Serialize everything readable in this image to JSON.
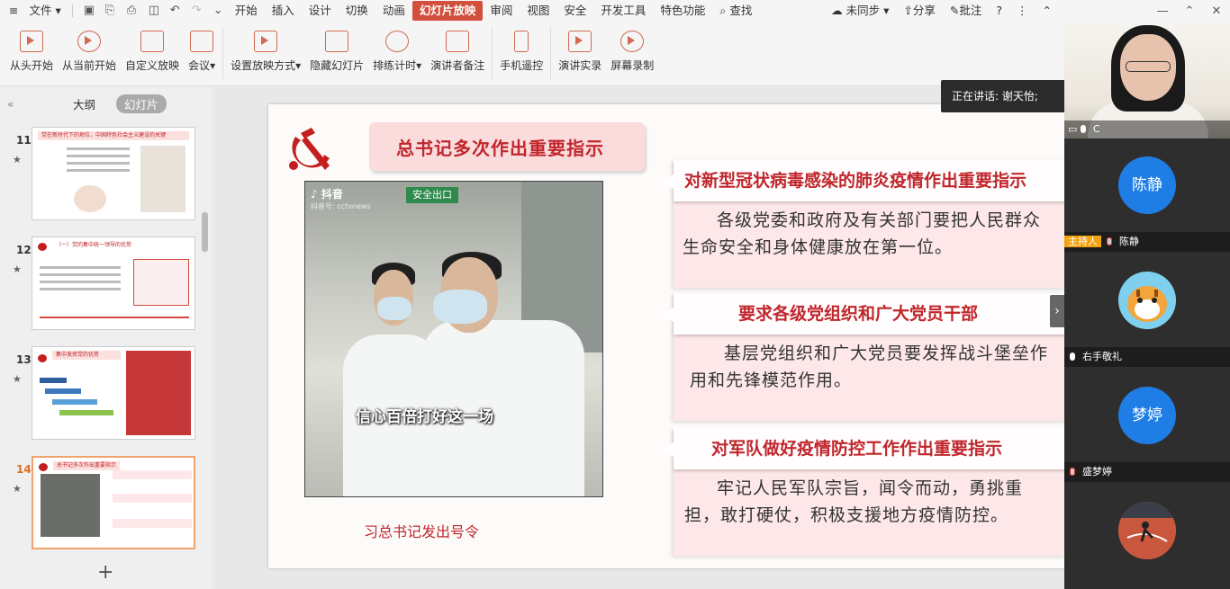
{
  "menubar": {
    "file": "文件",
    "tabs": [
      "开始",
      "插入",
      "设计",
      "切换",
      "动画",
      "幻灯片放映",
      "审阅",
      "视图",
      "安全",
      "开发工具",
      "特色功能"
    ],
    "active_tab": "幻灯片放映",
    "search": "查找",
    "sync": "未同步",
    "share": "分享",
    "comment": "批注",
    "help": "?"
  },
  "ribbon": {
    "buttons": [
      "从头开始",
      "从当前开始",
      "自定义放映",
      "会议",
      "设置放映方式",
      "隐藏幻灯片",
      "排练计时",
      "演讲者备注",
      "手机遥控",
      "演讲实录",
      "屏幕录制"
    ]
  },
  "left_panel": {
    "tab_outline": "大纲",
    "tab_slides": "幻灯片",
    "thumbnails": [
      {
        "num": "11",
        "title": "党在新时代下的地位，中国特色社会主义建设的关键"
      },
      {
        "num": "12",
        "title": "（一）党的集中统一领导的优势"
      },
      {
        "num": "13",
        "title": "集中发挥党的优势"
      },
      {
        "num": "14",
        "title": "总书记多次作出重要指示"
      }
    ],
    "selected": "14",
    "add": "+"
  },
  "slide": {
    "title": "总书记多次作出重要指示",
    "video": {
      "logo": "♪ 抖音",
      "account": "抖音号: cctvnews",
      "exit_sign": "安全出口",
      "caption": "信心百倍打好这一场"
    },
    "video_caption": "习总书记发出号令",
    "cards": [
      {
        "heading": "对新型冠状病毒感染的肺炎疫情作出重要指示",
        "body": "各级党委和政府及有关部门要把人民群众生命安全和身体健康放在第一位。"
      },
      {
        "heading": "要求各级党组织和广大党员干部",
        "body": "基层党组织和广大党员要发挥战斗堡垒作用和先锋模范作用。"
      },
      {
        "heading": "对军队做好疫情防控工作作出重要指示",
        "body": "牢记人民军队宗旨，闻令而动，勇挑重担，敢打硬仗，积极支援地方疫情防控。"
      }
    ]
  },
  "speaking": "正在讲话: 谢天怡;",
  "participants": {
    "camera_label": "C",
    "tiles": [
      {
        "avatar": "陈静",
        "role": "主持人",
        "name": "陈静"
      },
      {
        "avatar": "",
        "role": "",
        "name": "右手敬礼"
      },
      {
        "avatar": "梦婷",
        "role": "",
        "name": "盛梦婷"
      },
      {
        "avatar": "",
        "role": "",
        "name": ""
      }
    ]
  }
}
